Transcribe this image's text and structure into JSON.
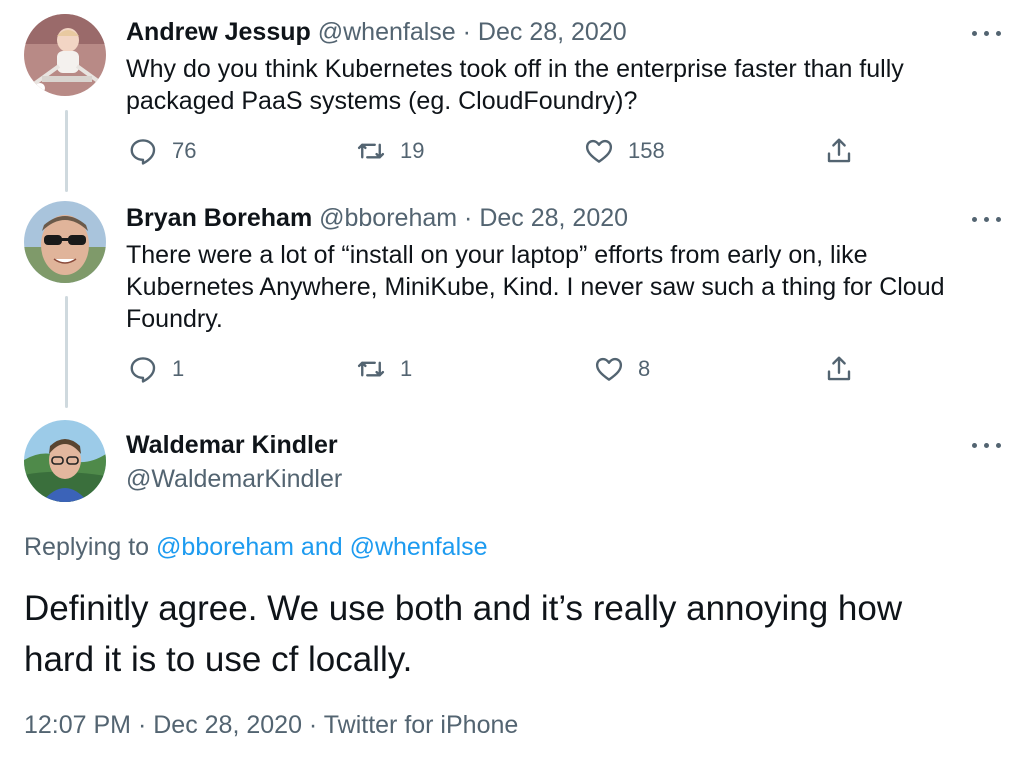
{
  "tweets": [
    {
      "name": "Andrew Jessup",
      "handle": "@whenfalse",
      "sep": "·",
      "date": "Dec 28, 2020",
      "text_lines": [
        "Why do you think Kubernetes took off in the enterprise faster than fully",
        "packaged PaaS systems (eg. CloudFoundry)?"
      ],
      "replies": "76",
      "retweets": "19",
      "likes": "158"
    },
    {
      "name": "Bryan Boreham",
      "handle": "@bboreham",
      "sep": "·",
      "date": "Dec 28, 2020",
      "text_lines": [
        "There were a lot of “install on your laptop” efforts from early on, like",
        "Kubernetes Anywhere, MiniKube, Kind. I never saw such a thing for Cloud",
        "Foundry."
      ],
      "replies": "1",
      "retweets": "1",
      "likes": "8"
    }
  ],
  "focal": {
    "name": "Waldemar Kindler",
    "handle": "@WaldemarKindler",
    "replying_prefix": "Replying to ",
    "replying_to_1": "@bboreham",
    "replying_and": " and ",
    "replying_to_2": "@whenfalse",
    "text_lines": [
      "Definitly agree. We use both and it’s really annoying how",
      "hard it is to use cf locally."
    ],
    "time": "12:07 PM",
    "sep": "·",
    "date": "Dec 28, 2020",
    "source": "Twitter for iPhone"
  },
  "icons": {
    "reply": "reply-icon",
    "retweet": "retweet-icon",
    "like": "heart-icon",
    "share": "share-icon",
    "more": "more-options-icon"
  },
  "colors": {
    "text": "#0f1419",
    "muted": "#536471",
    "link": "#1d9bf0",
    "thread_line": "#cfd9de"
  }
}
